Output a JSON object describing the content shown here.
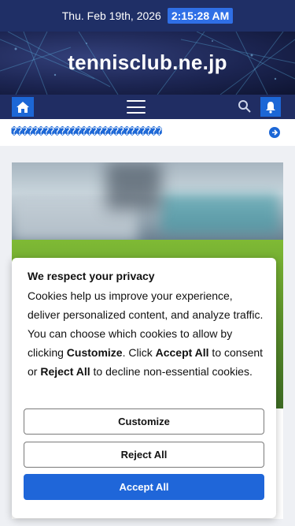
{
  "date_bar": {
    "date": "Thu. Feb 19th, 2026",
    "time": "2:15:28 AM"
  },
  "header": {
    "site_title": "tennisclub.ne.jp"
  },
  "nav": {
    "home_icon": "home-icon",
    "menu_icon": "hamburger-menu-icon",
    "search_icon": "search-icon",
    "bell_icon": "bell-icon"
  },
  "ticker": {
    "text": "����������������������������",
    "arrow_icon": "arrow-right-circle-icon"
  },
  "colors": {
    "navy": "#1f2f66",
    "accent_blue": "#1c67d6",
    "button_blue": "#1f66d9"
  },
  "cookie": {
    "title": "We respect your privacy",
    "body_part1": "Cookies help us improve your experience, deliver personalized content, and analyze traffic. You can choose which cookies to allow by clicking ",
    "customize_word": "Customize",
    "body_part2": ". Click ",
    "accept_word": "Accept All",
    "body_part3": " to consent or ",
    "reject_word": "Reject All",
    "body_part4": " to decline non-essential cookies.",
    "customize_label": "Customize",
    "reject_label": "Reject All",
    "accept_label": "Accept All"
  }
}
